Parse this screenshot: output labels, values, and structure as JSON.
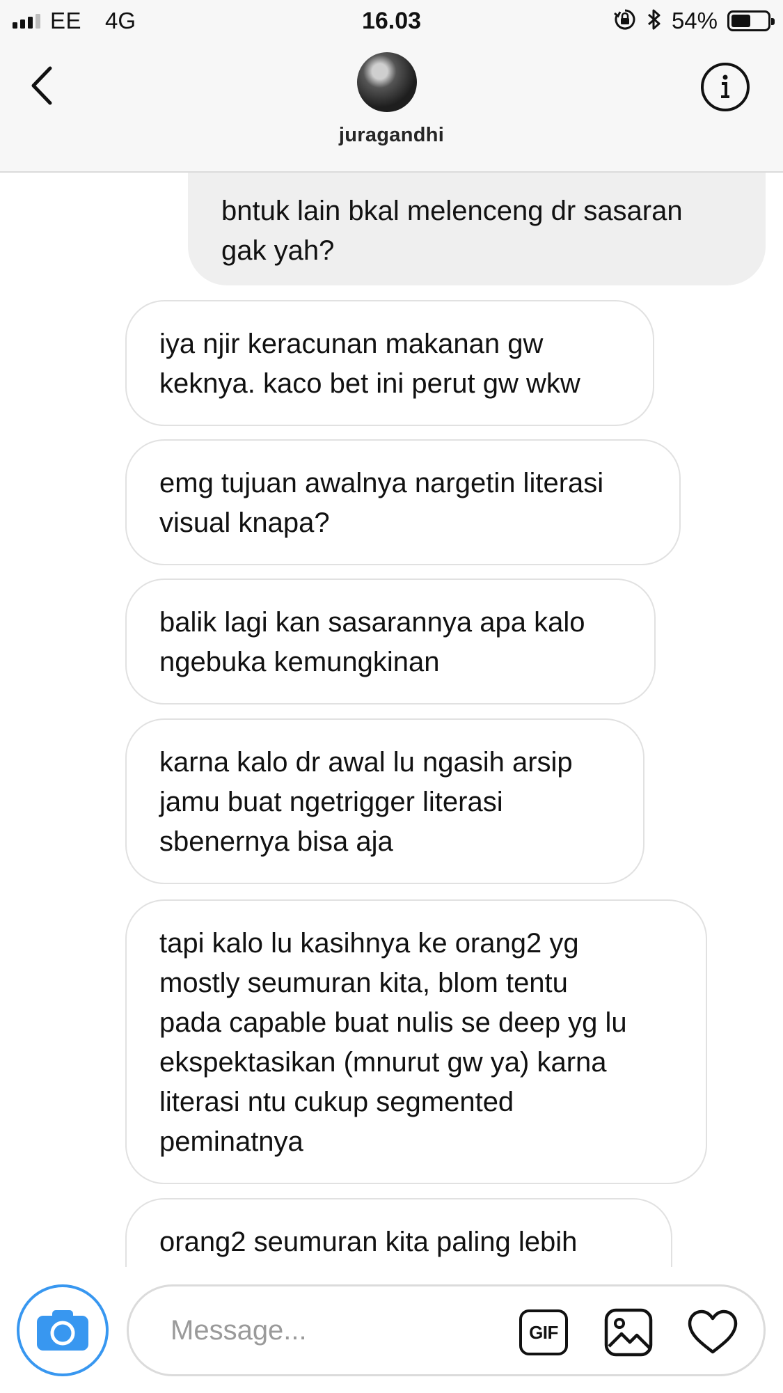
{
  "status_bar": {
    "carrier": "EE",
    "network": "4G",
    "time": "16.03",
    "battery_percent": "54%",
    "battery_level": 0.54,
    "icons": [
      "signal-icon",
      "orientation-lock-icon",
      "bluetooth-icon",
      "battery-icon"
    ]
  },
  "header": {
    "username": "juragandhi",
    "icons": [
      "chevron-left-icon",
      "info-icon"
    ]
  },
  "messages": [
    {
      "type": "sent",
      "text": "bntuk lain bkal melenceng dr sasaran\ngak yah?"
    },
    {
      "type": "received",
      "text": "iya njir keracunan makanan gw\nkeknya. kaco bet ini perut gw wkw"
    },
    {
      "type": "received",
      "text": "emg tujuan awalnya nargetin literasi\nvisual knapa?"
    },
    {
      "type": "received",
      "text": "balik lagi kan sasarannya apa kalo\nngebuka kemungkinan"
    },
    {
      "type": "received",
      "text": "karna kalo dr awal lu ngasih arsip\njamu buat ngetrigger literasi\nsbenernya bisa aja"
    },
    {
      "type": "received",
      "text": "tapi kalo lu kasihnya ke orang2 yg\nmostly seumuran kita, blom tentu\npada capable buat nulis se deep yg lu\nekspektasikan (mnurut gw ya) karna\nliterasi ntu cukup segmented\npeminatnya"
    },
    {
      "type": "received",
      "text": "orang2 seumuran kita paling lebih"
    }
  ],
  "composer": {
    "placeholder": "Message...",
    "value": "",
    "gif_label": "GIF",
    "accent_color": "#3897f0",
    "icons": [
      "camera-icon",
      "gif-icon",
      "image-icon",
      "heart-icon"
    ]
  }
}
